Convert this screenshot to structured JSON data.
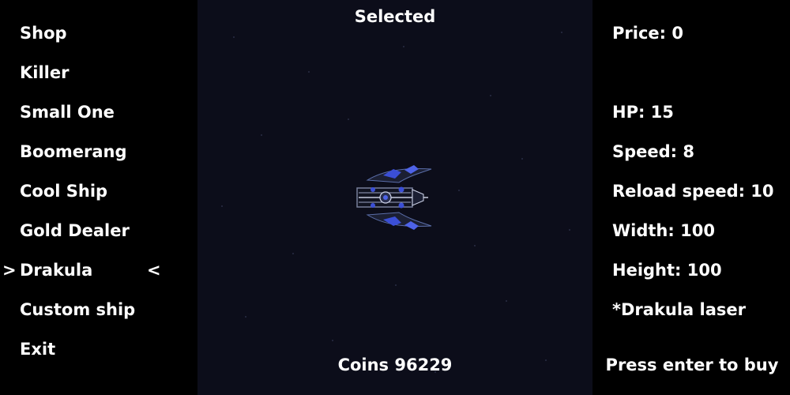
{
  "menu": {
    "items": [
      "Shop",
      "Killer",
      "Small One",
      "Boomerang",
      "Cool Ship",
      "Gold Dealer",
      "Drakula",
      "Custom ship",
      "Exit"
    ],
    "selected_prefix": ">",
    "selected_suffix": "<"
  },
  "center": {
    "title": "Selected",
    "coins": "Coins 96229",
    "ship_icon": "drakula-ship-icon"
  },
  "stats": {
    "price": "Price: 0",
    "hp": "HP: 15",
    "speed": "Speed: 8",
    "reload": "Reload speed: 10",
    "width": "Width: 100",
    "height": "Height: 100",
    "weapon": "*Drakula laser",
    "buy_prompt": "Press enter to buy"
  },
  "colors": {
    "background": "#000000",
    "space": "#0c0d1a",
    "text": "#ffffff",
    "ship_accent": "#3b4fd6"
  }
}
